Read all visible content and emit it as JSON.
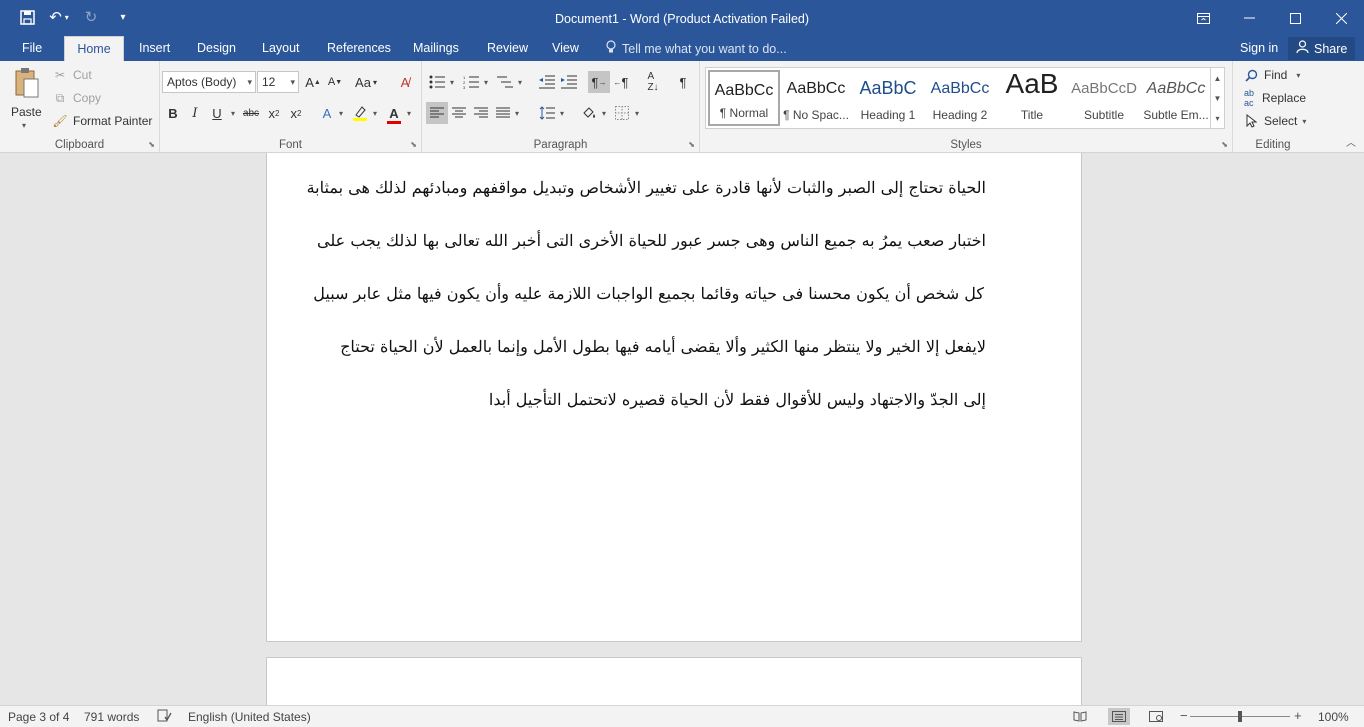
{
  "window": {
    "title": "Document1 - Word (Product Activation Failed)",
    "qat_icons": [
      "save-icon",
      "undo-icon",
      "redo-icon",
      "customize-icon"
    ]
  },
  "tabs": [
    "File",
    "Home",
    "Insert",
    "Design",
    "Layout",
    "References",
    "Mailings",
    "Review",
    "View"
  ],
  "active_tab": "Home",
  "tell_me": "Tell me what you want to do...",
  "sign_in": "Sign in",
  "share": "Share",
  "clipboard": {
    "paste": "Paste",
    "cut": "Cut",
    "copy": "Copy",
    "format_painter": "Format Painter",
    "label": "Clipboard"
  },
  "font": {
    "family": "Aptos (Body)",
    "size": "12",
    "label": "Font"
  },
  "paragraph": {
    "label": "Paragraph"
  },
  "styles": {
    "label": "Styles",
    "items": [
      {
        "preview": "AaBbCc",
        "name": "¶ Normal"
      },
      {
        "preview": "AaBbCc",
        "name": "¶ No Spac..."
      },
      {
        "preview": "AaBbC",
        "name": "Heading 1"
      },
      {
        "preview": "AaBbCc",
        "name": "Heading 2"
      },
      {
        "preview": "AaB",
        "name": "Title"
      },
      {
        "preview": "AaBbCcD",
        "name": "Subtitle"
      },
      {
        "preview": "AaBbCc",
        "name": "Subtle Em..."
      }
    ]
  },
  "editing": {
    "label": "Editing",
    "find": "Find",
    "replace": "Replace",
    "select": "Select"
  },
  "document": {
    "lines": [
      "الحياة تحتاج إلى الصبر والثبات لأنها قادرة على تغيير الأشخاص وتبديل مواقفهم ومبادئهم  لذلك هى بمثابة",
      "اختبار صعب يمرُ به جميع الناس وهى جسر عبور للحياة الأخرى التى أخبر الله تعالى بها لذلك يجب على",
      "كل شخص أن يكون محسنا فى حياته وقائما بجميع الواجبات اللازمة عليه وأن يكون فيها مثل عابر سبيل",
      "لايفعل إلا الخير ولا ينتظر منها الكثير وألا يقضى أيامه فيها بطول الأمل وإنما بالعمل لأن الحياة تحتاج",
      "إلى الجدّ والاجتهاد وليس للأقوال فقط لأن الحياة قصيره لاتحتمل التأجيل أبدا"
    ]
  },
  "status": {
    "page": "Page 3 of 4",
    "words": "791 words",
    "language": "English (United States)",
    "zoom": "100%"
  }
}
